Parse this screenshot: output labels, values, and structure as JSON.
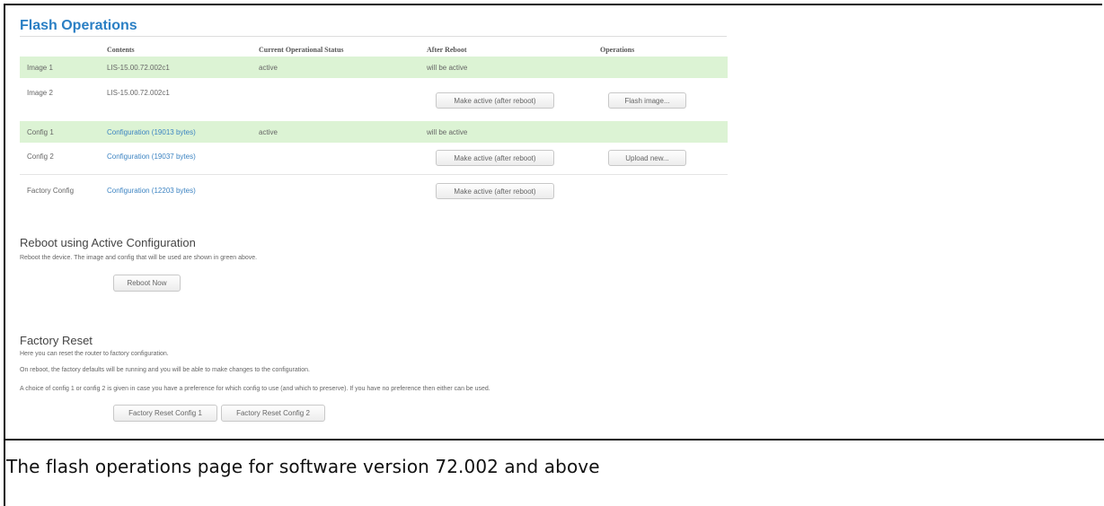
{
  "page_title": "Flash Operations",
  "columns": {
    "contents": "Contents",
    "status": "Current Operational Status",
    "after_reboot": "After Reboot",
    "operations": "Operations"
  },
  "rows": [
    {
      "name": "Image 1",
      "contents": "LIS-15.00.72.002c1",
      "status": "active",
      "after": "will be active"
    },
    {
      "name": "Image 2",
      "contents": "LIS-15.00.72.002c1",
      "after_button": "Make active (after reboot)",
      "op_button": "Flash image..."
    },
    {
      "name": "Config 1",
      "contents": "Configuration (19013 bytes)",
      "status": "active",
      "after": "will be active"
    },
    {
      "name": "Config 2",
      "contents": "Configuration (19037 bytes)",
      "after_button": "Make active (after reboot)",
      "op_button": "Upload new..."
    },
    {
      "name": "Factory Config",
      "contents": "Configuration (12203 bytes)",
      "after_button": "Make active (after reboot)"
    }
  ],
  "reboot": {
    "heading": "Reboot using Active Configuration",
    "text": "Reboot the device. The image and config that will be used are shown in green above.",
    "button": "Reboot Now"
  },
  "factory_reset": {
    "heading": "Factory Reset",
    "line1": "Here you can reset the router to factory configuration.",
    "line2": "On reboot, the factory defaults will be running and you will be able to make changes to the configuration.",
    "line3": "A choice of config 1 or config 2 is given in case you have a preference for which config to use (and which to preserve). If you have no preference then either can be used.",
    "button1": "Factory Reset Config 1",
    "button2": "Factory Reset Config 2"
  },
  "caption": "The flash operations page for software version 72.002 and above",
  "colors": {
    "accent": "#2a7fc4",
    "active_row": "#dcf3d4",
    "link": "#3d84c2"
  }
}
